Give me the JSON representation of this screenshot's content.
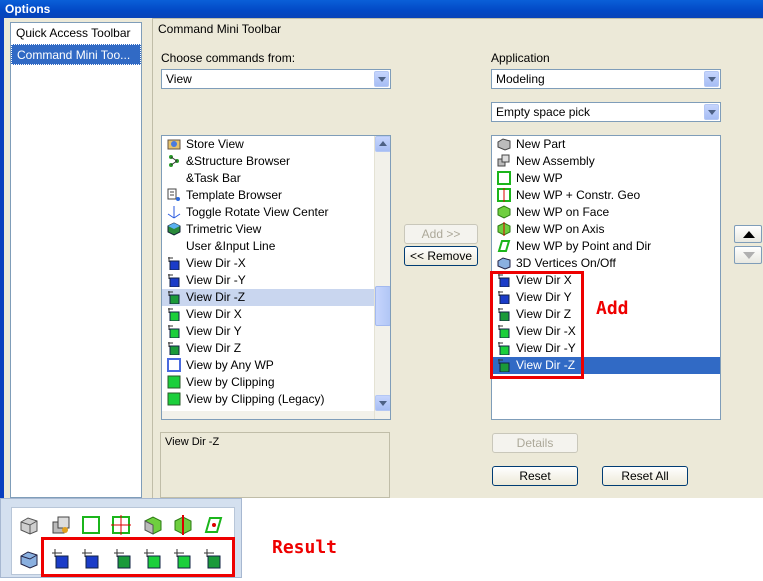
{
  "window": {
    "title": "Options"
  },
  "sidebar": {
    "items": [
      {
        "label": "Quick Access Toolbar",
        "selected": false
      },
      {
        "label": "Command Mini Too...",
        "selected": true
      }
    ]
  },
  "panel": {
    "title": "Command Mini Toolbar",
    "choose_label": "Choose commands from:",
    "choose_value": "View",
    "app_label": "Application",
    "app_value": "Modeling",
    "context_value": "Empty space pick",
    "add_button": "Add >>",
    "remove_button": "<< Remove",
    "description": "View Dir -Z",
    "details_button": "Details",
    "reset_button": "Reset",
    "reset_all_button": "Reset All"
  },
  "left_list": [
    {
      "label": "Store View",
      "icon": "store-view-icon"
    },
    {
      "label": "&Structure Browser",
      "icon": "structure-browser-icon"
    },
    {
      "label": "&Task Bar",
      "icon": ""
    },
    {
      "label": "Template Browser",
      "icon": "template-browser-icon"
    },
    {
      "label": "Toggle Rotate View Center",
      "icon": "rotate-center-icon"
    },
    {
      "label": "Trimetric View",
      "icon": "trimetric-icon"
    },
    {
      "label": "User &Input Line",
      "icon": ""
    },
    {
      "label": "View Dir -X",
      "icon": "view-dir-icon"
    },
    {
      "label": "View Dir -Y",
      "icon": "view-dir-icon"
    },
    {
      "label": "View Dir -Z",
      "icon": "view-dir-icon",
      "selected": true
    },
    {
      "label": "View Dir X",
      "icon": "view-dir-icon"
    },
    {
      "label": "View Dir Y",
      "icon": "view-dir-icon"
    },
    {
      "label": "View Dir Z",
      "icon": "view-dir-icon"
    },
    {
      "label": "View by Any WP",
      "icon": "view-wp-icon"
    },
    {
      "label": "View by Clipping",
      "icon": "view-clip-icon"
    },
    {
      "label": "View by Clipping (Legacy)",
      "icon": "view-clip-icon"
    }
  ],
  "right_list": [
    {
      "label": "New Part",
      "icon": "new-part-icon"
    },
    {
      "label": "New Assembly",
      "icon": "new-assembly-icon"
    },
    {
      "label": "New WP",
      "icon": "new-wp-icon"
    },
    {
      "label": "New WP + Constr. Geo",
      "icon": "new-wp-constr-icon"
    },
    {
      "label": "New WP on Face",
      "icon": "wp-face-icon"
    },
    {
      "label": "New WP on Axis",
      "icon": "wp-axis-icon"
    },
    {
      "label": "New WP by Point and Dir",
      "icon": "wp-point-dir-icon"
    },
    {
      "label": "3D Vertices On/Off",
      "icon": "vertices-icon"
    },
    {
      "label": "View Dir X",
      "icon": "view-dir-icon"
    },
    {
      "label": "View Dir Y",
      "icon": "view-dir-icon"
    },
    {
      "label": "View Dir Z",
      "icon": "view-dir-icon"
    },
    {
      "label": "View Dir -X",
      "icon": "view-dir-icon"
    },
    {
      "label": "View Dir -Y",
      "icon": "view-dir-icon"
    },
    {
      "label": "View Dir -Z",
      "icon": "view-dir-icon",
      "selected": true
    }
  ],
  "annotations": {
    "add": "Add",
    "result": "Result"
  },
  "colors": {
    "selection": "#316ac5",
    "annotation": "#e00000",
    "title_bar": "#0a5fd8"
  }
}
